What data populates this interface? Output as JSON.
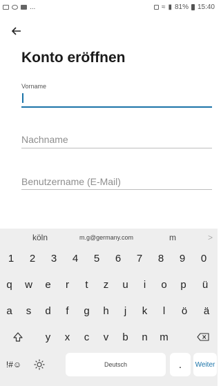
{
  "status_bar": {
    "signal_text": "81%",
    "time": "15:40",
    "ellipsis": "..."
  },
  "page": {
    "title": "Konto eröffnen"
  },
  "fields": {
    "vorname_label": "Vorname",
    "nachname_placeholder": "Nachname",
    "username_placeholder": "Benutzername (E-Mail)"
  },
  "keyboard": {
    "suggestions": [
      "köln",
      "m.g@germany.com",
      "m",
      ">"
    ],
    "row_numbers": [
      "1",
      "2",
      "3",
      "4",
      "5",
      "6",
      "7",
      "8",
      "9",
      "0"
    ],
    "row1": [
      "q",
      "w",
      "e",
      "r",
      "t",
      "z",
      "u",
      "i",
      "o",
      "p",
      "ü"
    ],
    "row2": [
      "a",
      "s",
      "d",
      "f",
      "g",
      "h",
      "j",
      "k",
      "l",
      "ö",
      "ä"
    ],
    "row3": [
      "y",
      "x",
      "c",
      "v",
      "b",
      "n",
      "m"
    ],
    "symbols_key": "!#☺",
    "space_label": "Deutsch",
    "period": ".",
    "action_label": "Weiter"
  }
}
